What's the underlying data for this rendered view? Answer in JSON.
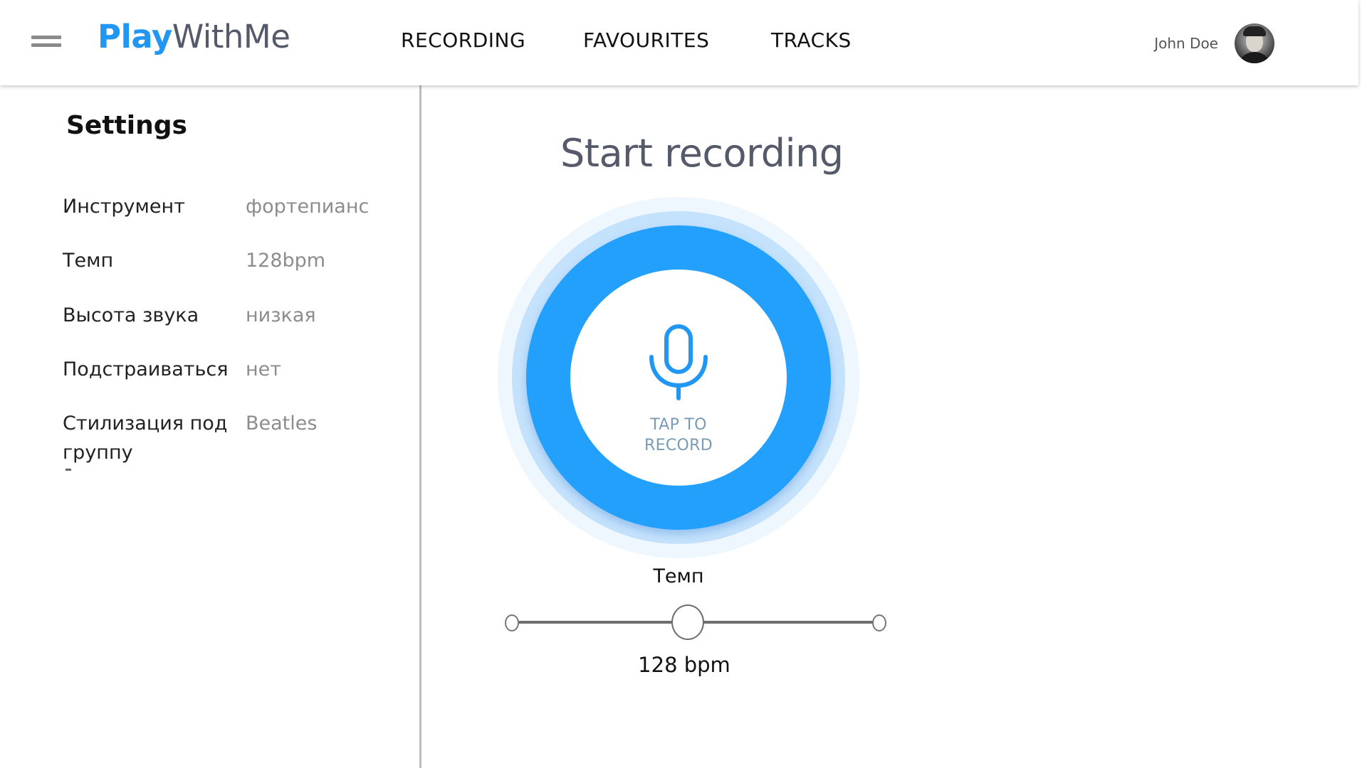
{
  "header": {
    "logo_play": "Play",
    "logo_rest": "WithMe",
    "nav": {
      "recording": "RECORDING",
      "favourites": "FAVOURITES",
      "tracks": "TRACKS"
    },
    "user_name": "John Doe"
  },
  "sidebar": {
    "title": "Settings",
    "settings": [
      {
        "label": "Инструмент",
        "value": "фортепианс"
      },
      {
        "label": "Темп",
        "value": "128bpm"
      },
      {
        "label": "Высота звука",
        "value": "низкая"
      },
      {
        "label": "Подстраиваться",
        "value": "нет"
      },
      {
        "label": "Стилизация под группу",
        "value": "Beatles"
      }
    ]
  },
  "main": {
    "title": "Start recording",
    "record_button": {
      "line1": "TAP TO",
      "line2": "RECORD",
      "icon": "microphone-icon"
    },
    "tempo": {
      "label": "Темп",
      "value_text": "128 bpm",
      "slider_fraction": 0.5
    }
  },
  "colors": {
    "accent": "#2196f3",
    "record_blue": "#22a0fb",
    "ring_light": "#c5e2fc",
    "ring_outer": "#eef6fe",
    "muted_text": "#8c8c8c",
    "title_text": "#555a6b"
  }
}
